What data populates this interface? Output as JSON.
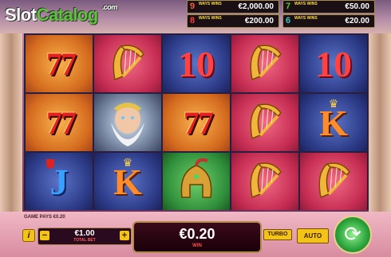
{
  "logo": {
    "part1": "Slot",
    "part2": "Catalog",
    "suffix": ".com"
  },
  "jackpots": [
    {
      "num": "9",
      "num_color": "#ff5a3a",
      "badge": "WAYS WINS",
      "amount": "€2,000.00"
    },
    {
      "num": "7",
      "num_color": "#5cc43a",
      "badge": "WAYS WINS",
      "amount": "€50.00"
    },
    {
      "num": "8",
      "num_color": "#ff3a3a",
      "badge": "WAYS WINS",
      "amount": "€200.00"
    },
    {
      "num": "6",
      "num_color": "#3ac4c4",
      "badge": "WAYS WINS",
      "amount": "€20.00"
    }
  ],
  "reels": [
    [
      "sevens",
      "sevens",
      "J"
    ],
    [
      "harp",
      "zeus",
      "K"
    ],
    [
      "10",
      "sevens",
      "helmet"
    ],
    [
      "harp",
      "harp",
      "harp"
    ],
    [
      "10",
      "K",
      "harp"
    ]
  ],
  "symbol_text": {
    "ten": "10",
    "j": "J",
    "k": "K",
    "sevens": "7 7",
    "harp": "♫",
    "helmet": "♞",
    "zeus": "☁"
  },
  "footer": {
    "game_pays": "GAME PAYS €0.20",
    "info_label": "i",
    "bet_value": "€1.00",
    "bet_label": "TOTAL BET",
    "minus": "−",
    "plus": "+",
    "win_value": "€0.20",
    "win_label": "WIN",
    "turbo": "TURBO",
    "auto": "AUTO",
    "spin_icon": "⟳"
  },
  "colors": {
    "accent": "#f3c316",
    "win_label": "#ff5050"
  }
}
